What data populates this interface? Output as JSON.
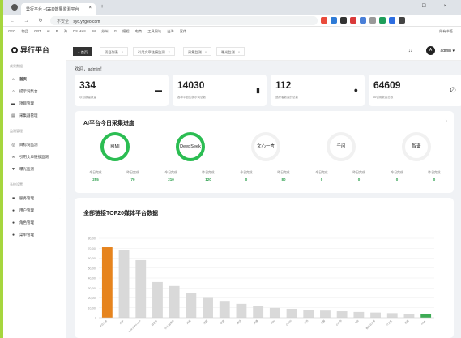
{
  "browser": {
    "tab_title": "异行平台 - GEO效果监测平台",
    "address": "syc.yzgeo.com",
    "not_secure_label": "不安全",
    "bookmarks": [
      "GEO",
      "物品",
      "GPT",
      "AI",
      "B",
      "海",
      "DS MAIL",
      "W",
      "苏州",
      "G",
      "编程",
      "电商",
      "工具网站",
      "出海",
      "宣传"
    ],
    "bookmarks_right": "所有书签"
  },
  "app": {
    "logo_text": "异行平台",
    "sidebar": {
      "groups": [
        "成果数据",
        "监测管理",
        "系统设置"
      ],
      "items": [
        {
          "label": "首页",
          "icon": "home-icon"
        },
        {
          "label": "提示词集合",
          "icon": "search-icon"
        },
        {
          "label": "项目管理",
          "icon": "folder-icon"
        },
        {
          "label": "采集器管理",
          "icon": "list-icon"
        },
        {
          "label": "目标词监测",
          "icon": "target-icon"
        },
        {
          "label": "引用文章链接监测",
          "icon": "link-icon"
        },
        {
          "label": "曝光监测",
          "icon": "filter-icon"
        },
        {
          "label": "服务管理",
          "icon": "server-icon"
        },
        {
          "label": "用户管理",
          "icon": "user-icon"
        },
        {
          "label": "角色管理",
          "icon": "user-icon"
        },
        {
          "label": "菜单管理",
          "icon": "user-icon"
        }
      ]
    },
    "tabs": [
      {
        "label": "首页"
      },
      {
        "label": "项目列表"
      },
      {
        "label": "引用文章链接监测"
      },
      {
        "label": "采集监测"
      },
      {
        "label": "曝光监测"
      }
    ],
    "user": {
      "initial": "A",
      "name": "admin"
    },
    "welcome": "欢迎，admin！",
    "stats": [
      {
        "value": "334",
        "label": "项目数量数量",
        "icon": "folder-icon"
      },
      {
        "value": "14030",
        "label": "各种平台的提示词总数",
        "icon": "clipboard-icon"
      },
      {
        "value": "112",
        "label": "追踪者数量的总数",
        "icon": "chat-icon"
      },
      {
        "value": "64609",
        "label": "AI引用数量总数",
        "icon": "link-icon"
      }
    ],
    "progress": {
      "title": "AI平台今日采集进度",
      "planned_label": "今日完成",
      "total_label": "昨日完成",
      "platforms": [
        {
          "name": "KIMI",
          "done": "255",
          "total": "70",
          "active": true
        },
        {
          "name": "DeepSeek",
          "done": "210",
          "total": "120",
          "active": true
        },
        {
          "name": "文心一言",
          "done": "0",
          "total": "80",
          "active": false
        },
        {
          "name": "千问",
          "done": "0",
          "total": "0",
          "active": false
        },
        {
          "name": "智谱",
          "done": "0",
          "total": "0",
          "active": false
        }
      ]
    },
    "top20": {
      "title": "全部链接TOP20媒体平台数据"
    }
  },
  "chart_data": {
    "type": "bar",
    "title": "全部链接TOP20媒体平台数据",
    "categories": [
      "今日头条",
      "知乎",
      "www.zhihu.com",
      "百家号",
      "什么值得买",
      "网易",
      "搜狐",
      "新浪",
      "腾讯",
      "凤凰",
      "36kr",
      "CSDN",
      "简书",
      "豆瓣",
      "小红书",
      "B站",
      "微信公众号",
      "IT之家",
      "界面",
      "other"
    ],
    "values": [
      71000,
      68500,
      58000,
      36000,
      32000,
      25000,
      20000,
      17000,
      14000,
      12000,
      10000,
      9000,
      8000,
      7200,
      6500,
      5800,
      5200,
      4600,
      4000,
      3500
    ],
    "ylim": [
      0,
      80000
    ],
    "yticks": [
      "80,000",
      "70,000",
      "60,000",
      "50,000",
      "40,000",
      "30,000",
      "20,000",
      "10,000",
      "0"
    ],
    "highlight_colors": {
      "first": "#e6841e",
      "last": "#3dab55",
      "default": "#d9d9d9"
    }
  }
}
